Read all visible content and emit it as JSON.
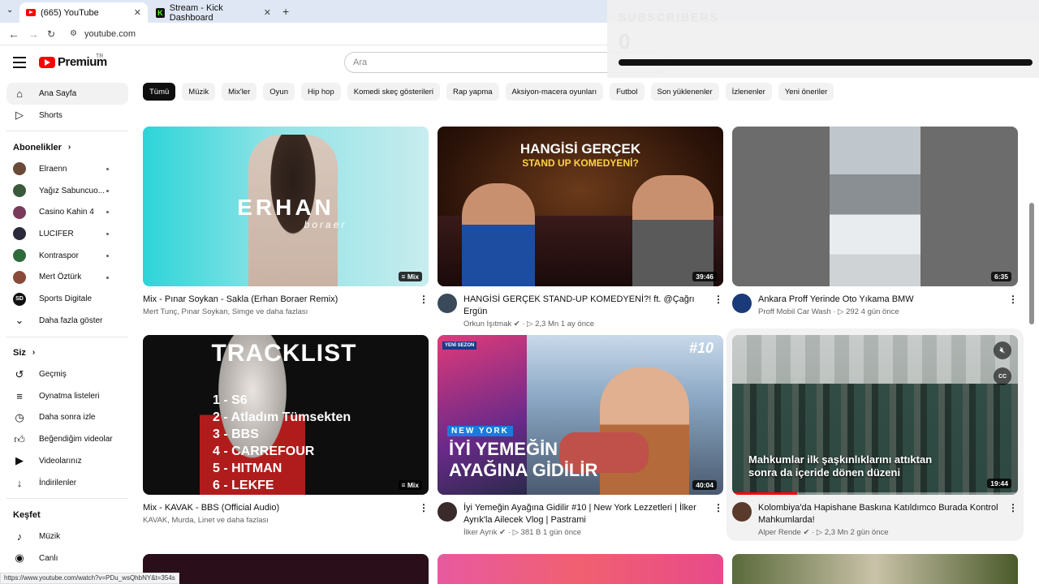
{
  "browser": {
    "tabs": [
      {
        "title": "(665) YouTube",
        "active": true
      },
      {
        "title": "Stream - Kick Dashboard",
        "active": false
      }
    ],
    "new_tab": "+",
    "url": "youtube.com",
    "status_url": "https://www.youtube.com/watch?v=PDu_wsQhbNY&t=354s"
  },
  "overlay": {
    "title": "SUBSCRIBERS",
    "count": "0"
  },
  "header": {
    "logo_text": "Premium",
    "logo_region": "TR",
    "search_placeholder": "Ara"
  },
  "sidebar": {
    "main": [
      {
        "label": "Ana Sayfa",
        "icon": "home-icon",
        "active": true
      },
      {
        "label": "Shorts",
        "icon": "shorts-icon"
      }
    ],
    "subscriptions_title": "Abonelikler",
    "subscriptions": [
      {
        "label": "Elraenn",
        "color": "#6b4a3a"
      },
      {
        "label": "Yağız Sabuncuo...",
        "color": "#3a5a3a"
      },
      {
        "label": "Casino Kahin 4",
        "color": "#7a3a5a"
      },
      {
        "label": "LUCIFER",
        "color": "#2a2a3a"
      },
      {
        "label": "Kontraspor",
        "color": "#2f6a3a"
      },
      {
        "label": "Mert Öztürk",
        "color": "#8a4a3a"
      },
      {
        "label": "Sports Digitale",
        "color": "#111111",
        "badge": "SD"
      }
    ],
    "show_more": "Daha fazla göster",
    "you_title": "Siz",
    "you": [
      {
        "label": "Geçmiş",
        "icon": "history-icon"
      },
      {
        "label": "Oynatma listeleri",
        "icon": "playlist-icon"
      },
      {
        "label": "Daha sonra izle",
        "icon": "clock-icon"
      },
      {
        "label": "Beğendiğim videolar",
        "icon": "thumbs-up-icon"
      },
      {
        "label": "Videolarınız",
        "icon": "video-icon"
      },
      {
        "label": "İndirilenler",
        "icon": "download-icon"
      }
    ],
    "explore_title": "Keşfet",
    "explore": [
      {
        "label": "Müzik",
        "icon": "music-icon"
      },
      {
        "label": "Canlı",
        "icon": "live-icon"
      }
    ]
  },
  "chips": [
    "Tümü",
    "Müzik",
    "Mix'ler",
    "Oyun",
    "Hip hop",
    "Komedi skeç gösterileri",
    "Rap yapma",
    "Aksiyon-macera oyunları",
    "Futbol",
    "Son yüklenenler",
    "İzlenenler",
    "Yeni öneriler"
  ],
  "videos": [
    {
      "title": "Mix - Pınar Soykan - Sakla (Erhan Boraer Remix)",
      "meta": "Mert Tunç, Pınar Soykan, Simge ve daha fazlası",
      "badge": "Mix",
      "thumb_text": "ERHAN",
      "thumb_sub": "boraer"
    },
    {
      "title": "HANGİSİ GERÇEK STAND-UP KOMEDYENİ?! ft. @Çağrı Ergün",
      "channel": "Orkun Işıtmak",
      "views": "2,3 Mn",
      "age": "1 ay önce",
      "duration": "39:46",
      "thumb_text": "HANGİSİ GERÇEK",
      "thumb_sub": "STAND UP KOMEDYENİ?"
    },
    {
      "title": "Ankara Proff Yerinde Oto Yıkama BMW",
      "channel": "Proff Mobil Car Wash",
      "views": "292",
      "age": "4 gün önce",
      "duration": "6:35"
    },
    {
      "title": "Mix - KAVAK - BBS (Official Audio)",
      "meta": "KAVAK, Murda, Linet ve daha fazlası",
      "badge": "Mix",
      "thumb_text": "TRACKLIST",
      "tracklist": [
        "1 - S6",
        "2 - Atladım Tümsekten",
        "3 - BBS",
        "4 - CARREFOUR",
        "5 - HITMAN",
        "6 - LEKFE"
      ]
    },
    {
      "title": "İyi Yemeğin Ayağına Gidilir #10 | New York Lezzetleri | İlker Ayrık'la Ailecek Vlog | Pastrami",
      "channel": "İlker Ayrık",
      "views": "381 B",
      "age": "1 gün önce",
      "duration": "40:04",
      "thumb_text": "İYİ YEMEĞİN",
      "thumb_sub": "AYAĞINA GİDİLİR",
      "thumb_tag": "NEW YORK",
      "thumb_num": "#10",
      "thumb_new": "YENİ SEZON"
    },
    {
      "title": "Kolombiya'da Hapishane Baskına Katıldımco Burada Kontrol Mahkumlarda!",
      "channel": "Alper Rende",
      "views": "2,3 Mn",
      "age": "2 gün önce",
      "duration": "19:44",
      "thumb_text": "Mahkumlar ilk şaşkınlıklarını attıktan sonra da içeride dönen düzeni",
      "cc": "CC"
    }
  ]
}
